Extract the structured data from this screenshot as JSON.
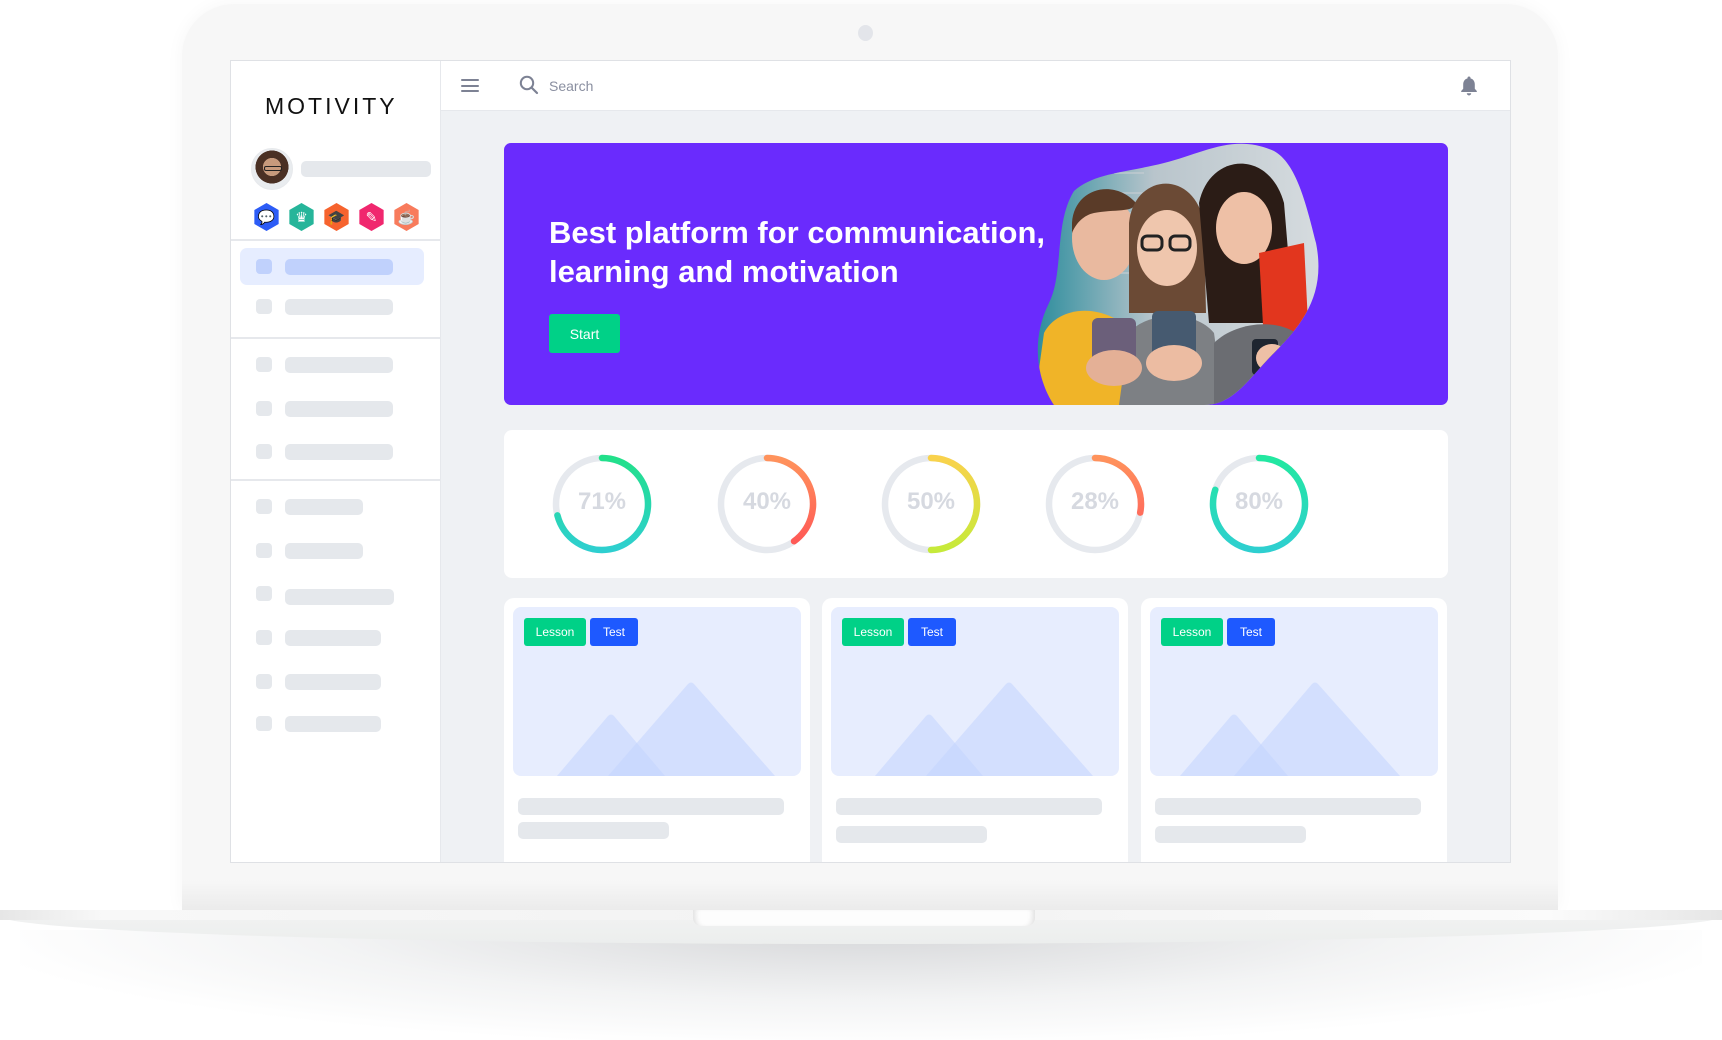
{
  "app": {
    "brand": "MOTIVITY"
  },
  "topbar": {
    "menu_icon": "hamburger-menu-icon",
    "search_icon": "search-icon",
    "search_placeholder": "Search",
    "search_value": "",
    "notification_icon": "bell-icon"
  },
  "sidebar": {
    "user": {
      "avatar": "user-avatar",
      "name": ""
    },
    "badges": [
      {
        "icon": "chat-bubble-icon",
        "color": "#2c5cf6"
      },
      {
        "icon": "crown-icon",
        "color": "#26b59a"
      },
      {
        "icon": "graduation-cap-icon",
        "color": "#f6632e"
      },
      {
        "icon": "pencil-icon",
        "color": "#f0276e"
      },
      {
        "icon": "cup-icon",
        "color": "#f87b5c"
      }
    ],
    "groups": [
      {
        "items": [
          {
            "label": "",
            "active": true
          },
          {
            "label": "",
            "active": false
          }
        ]
      },
      {
        "items": [
          {
            "label": "",
            "active": false
          },
          {
            "label": "",
            "active": false
          },
          {
            "label": "",
            "active": false
          }
        ]
      },
      {
        "items": [
          {
            "label": "",
            "active": false
          },
          {
            "label": "",
            "active": false
          },
          {
            "label": "",
            "active": false
          },
          {
            "label": "",
            "active": false
          },
          {
            "label": "",
            "active": false
          },
          {
            "label": "",
            "active": false
          }
        ]
      }
    ]
  },
  "banner": {
    "title": "Best platform for communication, learning and motivation",
    "cta_label": "Start",
    "background_color": "#6a2bfd",
    "cta_color": "#00d187",
    "image": "students-with-phones-photo"
  },
  "progress": [
    {
      "label": "71%",
      "value": 71,
      "colors": [
        "#22e08a",
        "#2ecfd0"
      ]
    },
    {
      "label": "40%",
      "value": 40,
      "colors": [
        "#ff935c",
        "#ff5a56"
      ]
    },
    {
      "label": "50%",
      "value": 50,
      "colors": [
        "#f9d24c",
        "#c6ea3a"
      ]
    },
    {
      "label": "28%",
      "value": 28,
      "colors": [
        "#ff935c",
        "#ff6e5c"
      ]
    },
    {
      "label": "80%",
      "value": 80,
      "colors": [
        "#22e8a0",
        "#2ecfd0"
      ]
    }
  ],
  "cards": [
    {
      "tags": [
        {
          "label": "Lesson",
          "color": "#00d187"
        },
        {
          "label": "Test",
          "color": "#1e59ff"
        }
      ],
      "image": "image-placeholder-icon",
      "title": "",
      "subtitle": ""
    },
    {
      "tags": [
        {
          "label": "Lesson",
          "color": "#00d187"
        },
        {
          "label": "Test",
          "color": "#1e59ff"
        }
      ],
      "image": "image-placeholder-icon",
      "title": "",
      "subtitle": ""
    },
    {
      "tags": [
        {
          "label": "Lesson",
          "color": "#00d187"
        },
        {
          "label": "Test",
          "color": "#1e59ff"
        }
      ],
      "image": "image-placeholder-icon",
      "title": "",
      "subtitle": ""
    }
  ]
}
